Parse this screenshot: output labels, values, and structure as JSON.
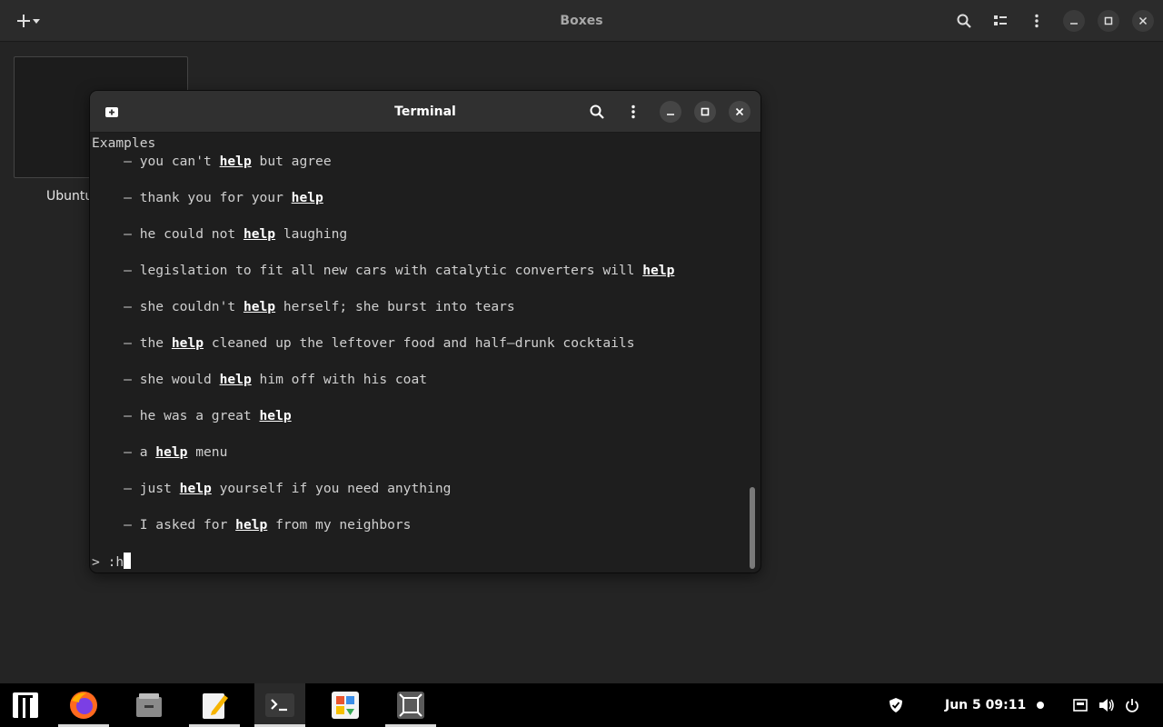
{
  "boxes": {
    "title": "Boxes",
    "vm_name": "Ubuntu"
  },
  "terminal": {
    "title": "Terminal",
    "lines": [
      {
        "parts": [
          {
            "t": "Examples",
            "hl": false
          }
        ]
      },
      {
        "parts": [
          {
            "t": "    – you can't ",
            "hl": false
          },
          {
            "t": "help",
            "hl": true
          },
          {
            "t": " but agree",
            "hl": false
          }
        ]
      },
      {
        "parts": [
          {
            "t": "",
            "hl": false
          }
        ]
      },
      {
        "parts": [
          {
            "t": "    – thank you for your ",
            "hl": false
          },
          {
            "t": "help",
            "hl": true
          }
        ]
      },
      {
        "parts": [
          {
            "t": "",
            "hl": false
          }
        ]
      },
      {
        "parts": [
          {
            "t": "    – he could not ",
            "hl": false
          },
          {
            "t": "help",
            "hl": true
          },
          {
            "t": " laughing",
            "hl": false
          }
        ]
      },
      {
        "parts": [
          {
            "t": "",
            "hl": false
          }
        ]
      },
      {
        "parts": [
          {
            "t": "    – legislation to fit all new cars with catalytic converters will ",
            "hl": false
          },
          {
            "t": "help",
            "hl": true
          }
        ]
      },
      {
        "parts": [
          {
            "t": "",
            "hl": false
          }
        ]
      },
      {
        "parts": [
          {
            "t": "    – she couldn't ",
            "hl": false
          },
          {
            "t": "help",
            "hl": true
          },
          {
            "t": " herself; she burst into tears",
            "hl": false
          }
        ]
      },
      {
        "parts": [
          {
            "t": "",
            "hl": false
          }
        ]
      },
      {
        "parts": [
          {
            "t": "    – the ",
            "hl": false
          },
          {
            "t": "help",
            "hl": true
          },
          {
            "t": " cleaned up the leftover food and half–drunk cocktails",
            "hl": false
          }
        ]
      },
      {
        "parts": [
          {
            "t": "",
            "hl": false
          }
        ]
      },
      {
        "parts": [
          {
            "t": "    – she would ",
            "hl": false
          },
          {
            "t": "help",
            "hl": true
          },
          {
            "t": " him off with his coat",
            "hl": false
          }
        ]
      },
      {
        "parts": [
          {
            "t": "",
            "hl": false
          }
        ]
      },
      {
        "parts": [
          {
            "t": "    – he was a great ",
            "hl": false
          },
          {
            "t": "help",
            "hl": true
          }
        ]
      },
      {
        "parts": [
          {
            "t": "",
            "hl": false
          }
        ]
      },
      {
        "parts": [
          {
            "t": "    – a ",
            "hl": false
          },
          {
            "t": "help",
            "hl": true
          },
          {
            "t": " menu",
            "hl": false
          }
        ]
      },
      {
        "parts": [
          {
            "t": "",
            "hl": false
          }
        ]
      },
      {
        "parts": [
          {
            "t": "    – just ",
            "hl": false
          },
          {
            "t": "help",
            "hl": true
          },
          {
            "t": " yourself if you need anything",
            "hl": false
          }
        ]
      },
      {
        "parts": [
          {
            "t": "",
            "hl": false
          }
        ]
      },
      {
        "parts": [
          {
            "t": "    – I asked for ",
            "hl": false
          },
          {
            "t": "help",
            "hl": true
          },
          {
            "t": " from my neighbors",
            "hl": false
          }
        ]
      },
      {
        "parts": [
          {
            "t": "",
            "hl": false
          }
        ]
      }
    ],
    "prompt": "> :h"
  },
  "taskbar": {
    "apps": [
      {
        "name": "firefox",
        "icon": "firefox-icon",
        "running": true,
        "active": false
      },
      {
        "name": "files",
        "icon": "files-icon",
        "running": false,
        "active": false
      },
      {
        "name": "text-editor",
        "icon": "text-editor-icon",
        "running": true,
        "active": false
      },
      {
        "name": "terminal",
        "icon": "terminal-icon",
        "running": true,
        "active": true
      },
      {
        "name": "software",
        "icon": "software-icon",
        "running": false,
        "active": false
      },
      {
        "name": "boxes",
        "icon": "boxes-icon",
        "running": true,
        "active": false
      }
    ],
    "clock": "Jun 5  09:11"
  },
  "colors": {
    "background": "#242424",
    "header": "#2b2b2b",
    "terminal_bg": "#1e1e1e",
    "taskbar": "#000000"
  }
}
